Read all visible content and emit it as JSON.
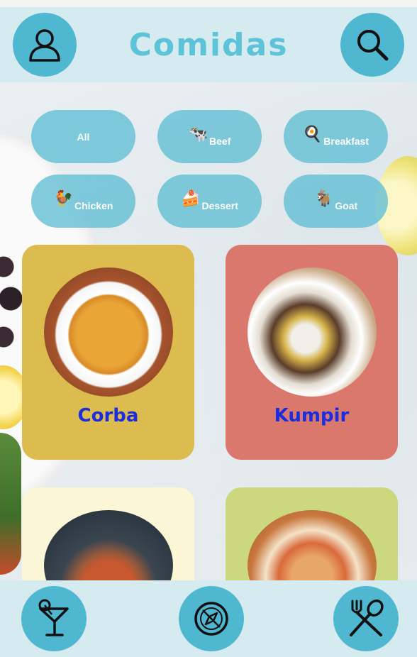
{
  "header": {
    "title": "Comidas",
    "profile_icon": "user-icon",
    "search_icon": "search-icon"
  },
  "categories": [
    {
      "label": "All",
      "icon": "none"
    },
    {
      "label": "Beef",
      "icon": "cow-icon"
    },
    {
      "label": "Breakfast",
      "icon": "breakfast-icon"
    },
    {
      "label": "Chicken",
      "icon": "rooster-icon"
    },
    {
      "label": "Dessert",
      "icon": "cake-icon"
    },
    {
      "label": "Goat",
      "icon": "goat-icon"
    }
  ],
  "meals": [
    {
      "name": "Corba",
      "color": "#dcbc4f"
    },
    {
      "name": "Kumpir",
      "color": "#db786d"
    },
    {
      "name": "",
      "color": "#faf6d6"
    },
    {
      "name": "",
      "color": "#ccd87e"
    }
  ],
  "footer": {
    "left_icon": "cocktail-icon",
    "middle_icon": "compass-icon",
    "right_icon": "fork-spoon-icon"
  },
  "colors": {
    "bar": "#d6ebf0",
    "accent": "#4fb7d0",
    "title": "#5cc3d8",
    "meal_name": "#1a2ee0"
  }
}
